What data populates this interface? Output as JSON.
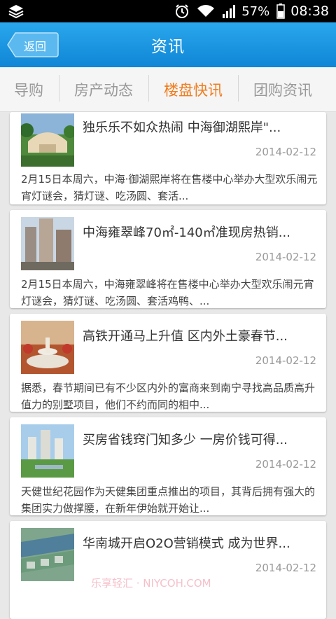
{
  "status": {
    "battery": "57%",
    "time": "08:38"
  },
  "header": {
    "back_label": "返回",
    "title": "资讯"
  },
  "tabs": [
    {
      "label": "导购"
    },
    {
      "label": "房产动态"
    },
    {
      "label": "楼盘快讯"
    },
    {
      "label": "团购资讯"
    }
  ],
  "active_tab": "楼盘快讯",
  "news": [
    {
      "title": "独乐乐不如众热闹 中海御湖熙岸\"...",
      "date": "2014-02-12",
      "summary": "2月15日本周六，中海·御湖熙岸将在售楼中心举办大型欢乐闹元宵灯谜会，猜灯谜、吃汤圆、套活...",
      "thumb": "villa-garden"
    },
    {
      "title": "中海雍翠峰70㎡-140㎡准现房热销...",
      "date": "2014-02-12",
      "summary": "2月15日本周六，中海雍翠峰将在售楼中心举办大型欢乐闹元宵灯谜会，猜灯谜、吃汤圆、套活鸡鸭、...",
      "thumb": "high-rise"
    },
    {
      "title": "高铁开通马上升值 区内外土豪春节...",
      "date": "2014-02-12",
      "summary": "据悉，春节期间已有不少区内外的富商来到南宁寻找高品质高升值力的别墅项目，他们不约而同的相中...",
      "thumb": "fountain"
    },
    {
      "title": "买房省钱窍门知多少 一房价钱可得...",
      "date": "2014-02-12",
      "summary": "天健世纪花园作为天健集团重点推出的项目，其背后拥有强大的集团实力做撑腰，在新年伊始就开始让...",
      "thumb": "garden-towers"
    },
    {
      "title": "华南城开启O2O营销模式 成为世界...",
      "date": "2014-02-12",
      "summary": "",
      "thumb": "complex-aerial"
    }
  ],
  "watermark": "乐享轻汇 · NIYCOH.COM"
}
